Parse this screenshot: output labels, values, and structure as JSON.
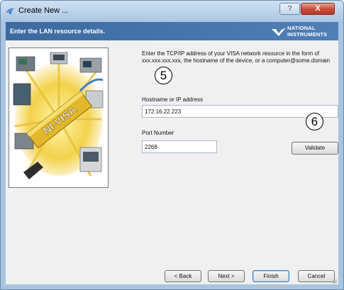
{
  "window": {
    "title": "Create New ...",
    "help_label": "?",
    "close_label": "X"
  },
  "header": {
    "text": "Enter the LAN resource details.",
    "logo_line1": "NATIONAL",
    "logo_line2": "INSTRUMENTS"
  },
  "image": {
    "banner_text": "NI-VISA"
  },
  "form": {
    "description": "Enter the TCP/IP address of your VISA network resource in the form of xxx.xxx.xxx.xxx, the hostname of the device, or a computer@some.domain",
    "hostname_label": "Hostname or IP address",
    "hostname_value": "172.16.22.223",
    "port_label": "Port Number",
    "port_value": "2268",
    "validate_label": "Validate"
  },
  "callouts": {
    "first": "5",
    "second": "6"
  },
  "footer": {
    "back_label": "< Back",
    "next_label": "Next >",
    "finish_label": "Finish",
    "cancel_label": "Cancel"
  }
}
